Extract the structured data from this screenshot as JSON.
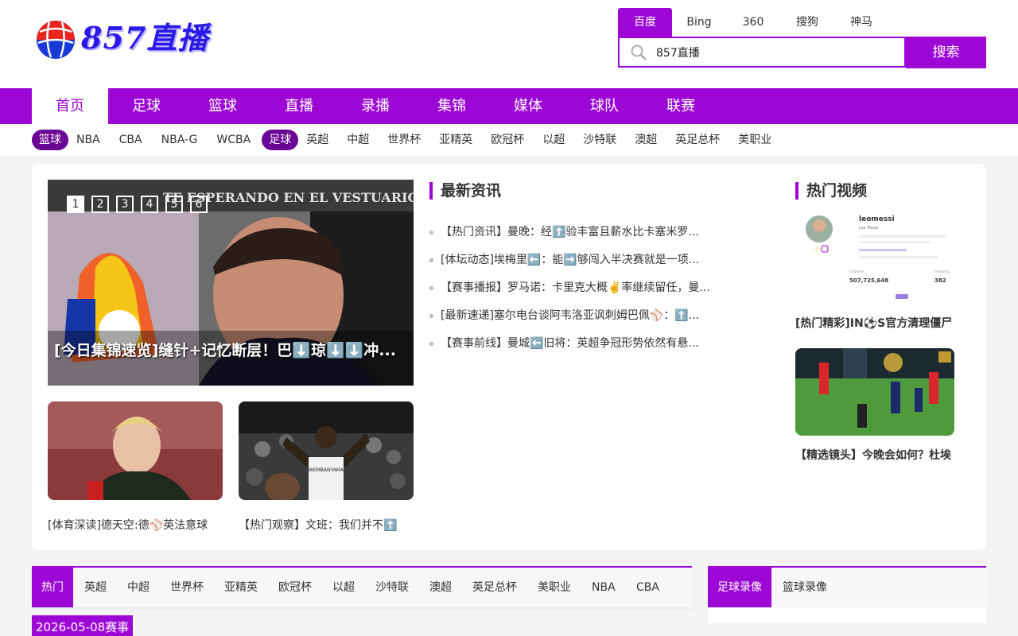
{
  "brand": {
    "logo_text": "857直播"
  },
  "search": {
    "engines": [
      "百度",
      "Bing",
      "360",
      "搜狗",
      "神马"
    ],
    "active_engine": "百度",
    "query": "857直播",
    "button_label": "搜索"
  },
  "main_nav": [
    "首页",
    "足球",
    "篮球",
    "直播",
    "录播",
    "集锦",
    "媒体",
    "球队",
    "联赛"
  ],
  "sub_nav": {
    "basketball_label": "篮球",
    "basketball_links": [
      "NBA",
      "CBA",
      "NBA-G",
      "WCBA"
    ],
    "football_label": "足球",
    "football_links": [
      "英超",
      "中超",
      "世界杯",
      "亚精英",
      "欧冠杯",
      "以超",
      "沙特联",
      "澳超",
      "英足总杯",
      "美职业"
    ]
  },
  "slider": {
    "dots": [
      "1",
      "2",
      "3",
      "4",
      "5",
      "6"
    ],
    "active_dot": "1",
    "caption": "[今日集锦速览]缝针+记忆断层！巴⬇️琼⬇️⬇️冲...",
    "image_text": "TE ESPERANDO EN EL VESTUARIO DEL MADRID"
  },
  "thumbs": [
    {
      "caption": "[体育深读]德天空:德⚾英法意球"
    },
    {
      "caption": "【热门观察】文班：我们并不⬆️",
      "jersey": "WEMBANYAMA"
    }
  ],
  "latest_news": {
    "title": "最新资讯",
    "items": [
      "【热门资讯】曼晚：经⬆️验丰富且薪水比卡塞米罗...",
      "[体坛动态]埃梅里⬅️：能➡️够闯入半决赛就是一项...",
      "【赛事播报】罗马诺：卡里克大概✌️率继续留任，曼...",
      "[最新速递]塞尔电台谈阿韦洛亚讽刺姆巴佩⚾：⬆️...",
      "【赛事前线】曼城⬅️旧将：英超争冠形势依然有悬..."
    ]
  },
  "hot_videos": {
    "title": "热门视频",
    "items": [
      {
        "caption": "[热门精彩]IN⚽S官方清理僵尸",
        "profile_name": "leomessi",
        "profile_sub": "Leo Messi",
        "followers_label": "Followers",
        "followers": "507,725,648",
        "following_label": "Following",
        "following": "382"
      },
      {
        "caption": "【精选镜头】今晚会如何？杜埃"
      }
    ]
  },
  "league_tabs": [
    "热门",
    "英超",
    "中超",
    "世界杯",
    "亚精英",
    "欧冠杯",
    "以超",
    "沙特联",
    "澳超",
    "英足总杯",
    "美职业",
    "NBA",
    "CBA"
  ],
  "match_date": "2026-05-08赛事",
  "recording_tabs": [
    "足球录像",
    "篮球录像"
  ],
  "colors": {
    "accent": "#9c07d6",
    "pill": "#6b0594"
  }
}
